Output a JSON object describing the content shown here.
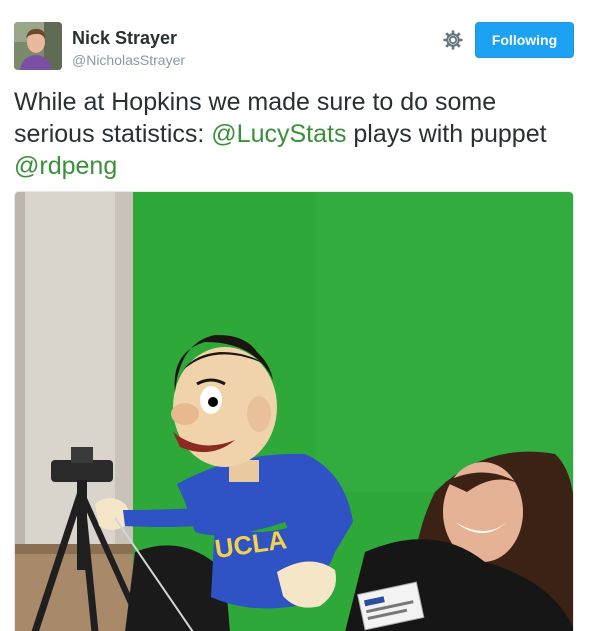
{
  "author": {
    "name": "Nick Strayer",
    "handle": "@NicholasStrayer"
  },
  "follow_button": {
    "label": "Following"
  },
  "tweet": {
    "text_1": "While at Hopkins we made sure to do some serious statistics: ",
    "mention_1": "@LucyStats",
    "text_2": " plays with puppet ",
    "mention_2": "@rdpeng"
  },
  "media": {
    "shirt_text": "UCLA",
    "icons": [
      "settings-gear-icon"
    ]
  },
  "colors": {
    "link": "#3b8f3b",
    "button": "#1da1f2",
    "greenscreen": "#2fa83a"
  }
}
